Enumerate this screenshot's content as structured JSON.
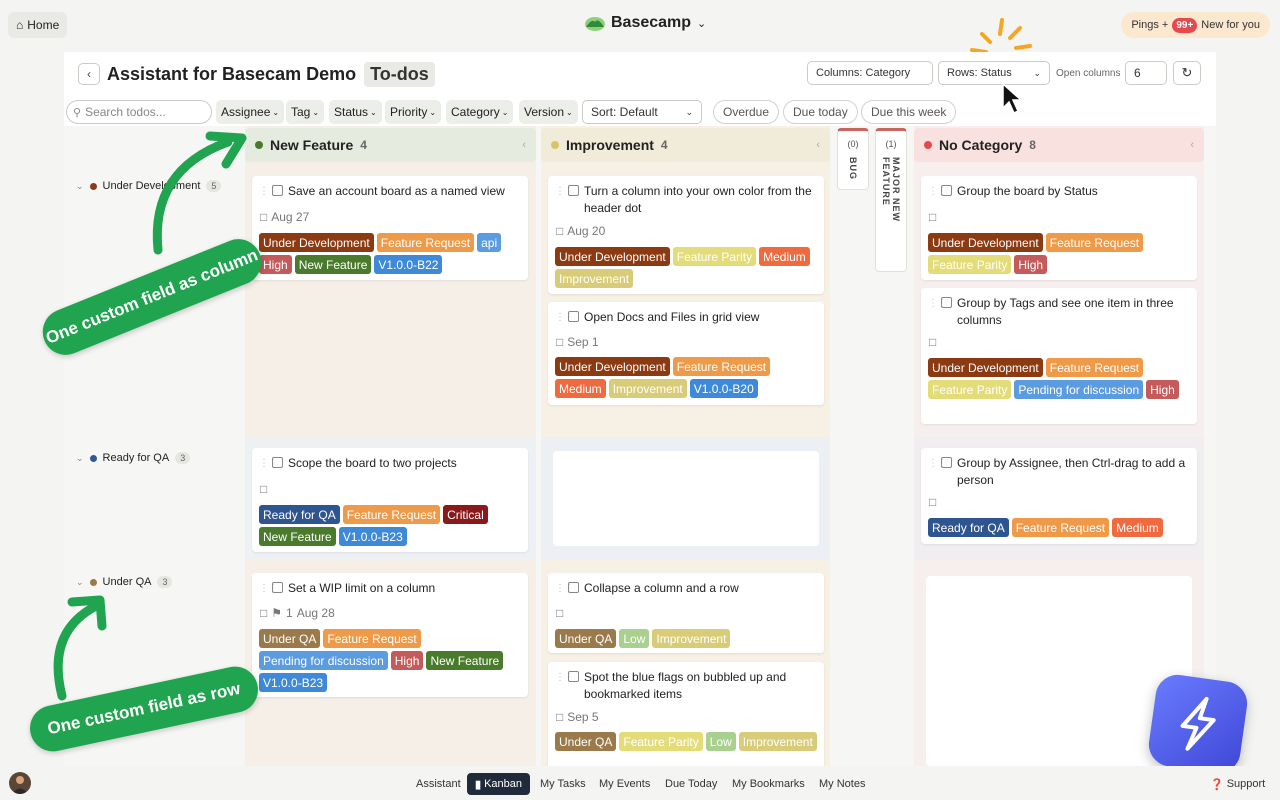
{
  "topbar": {
    "home_label": "Home",
    "brand": "Basecamp",
    "pings_label": "Pings +",
    "pings_count": "99+",
    "new_for_you": "New for you"
  },
  "header": {
    "title": "Assistant for Basecam Demo",
    "section": "To-dos",
    "columns_select": "Columns: Category",
    "rows_select": "Rows: Status",
    "open_columns_label": "Open columns",
    "open_columns_value": "6"
  },
  "filters": {
    "search_placeholder": "Search todos...",
    "chips": [
      "Assignee",
      "Tag",
      "Status",
      "Priority",
      "Category",
      "Version"
    ],
    "sort": "Sort: Default",
    "pills": [
      "Overdue",
      "Due today",
      "Due this week"
    ]
  },
  "columns": [
    {
      "name": "New Feature",
      "count": "4",
      "color": "#4a7a2c"
    },
    {
      "name": "Improvement",
      "count": "4",
      "color": "#d6c46a"
    },
    {
      "name": "No Category",
      "count": "8",
      "color": "#e5484d"
    }
  ],
  "collapsed_columns": [
    {
      "count": "(0)",
      "name": "BUG"
    },
    {
      "count": "(1)",
      "name": "MAJOR NEW FEATURE"
    }
  ],
  "rows": [
    {
      "name": "Under Development",
      "count": "5",
      "color": "#8b3a1a"
    },
    {
      "name": "Ready for QA",
      "count": "3",
      "color": "#2e5a9a"
    },
    {
      "name": "Under QA",
      "count": "3",
      "color": "#9a7a4a"
    }
  ],
  "cards": {
    "c1": {
      "title": "Save an account board as a named view",
      "date": "Aug 27",
      "tags": [
        "Under Development",
        "Feature Request",
        "api",
        "High",
        "New Feature",
        "V1.0.0-B22"
      ]
    },
    "c2": {
      "title": "Turn a column into your own color from the header dot",
      "date": "Aug 20",
      "tags": [
        "Under Development",
        "Feature Parity",
        "Medium",
        "Improvement"
      ]
    },
    "c3": {
      "title": "Open Docs and Files in grid view",
      "date": "Sep 1",
      "tags": [
        "Under Development",
        "Feature Request",
        "Medium",
        "Improvement",
        "V1.0.0-B20"
      ]
    },
    "c4": {
      "title": "Group the board by Status",
      "tags": [
        "Under Development",
        "Feature Request",
        "Feature Parity",
        "High"
      ]
    },
    "c5": {
      "title": "Group by Tags and see one item in three columns",
      "tags": [
        "Under Development",
        "Feature Request",
        "Feature Parity",
        "Pending for discussion",
        "High"
      ]
    },
    "c6": {
      "title": "Scope the board to two projects",
      "tags": [
        "Ready for QA",
        "Feature Request",
        "Critical",
        "New Feature",
        "V1.0.0-B23"
      ]
    },
    "c7": {
      "title": "Group by Assignee, then Ctrl-drag to add a person",
      "tags": [
        "Ready for QA",
        "Feature Request",
        "Medium"
      ]
    },
    "c8": {
      "title": "Set a WIP limit on a column",
      "comments": "1",
      "date": "Aug 28",
      "tags": [
        "Under QA",
        "Feature Request",
        "Pending for discussion",
        "High",
        "New Feature",
        "V1.0.0-B23"
      ]
    },
    "c9": {
      "title": "Collapse a column and a row",
      "tags": [
        "Under QA",
        "Low",
        "Improvement"
      ]
    },
    "c10": {
      "title": "Spot the blue flags on bubbled up and bookmarked items",
      "date": "Sep 5",
      "tags": [
        "Under QA",
        "Feature Parity",
        "Low",
        "Improvement"
      ]
    }
  },
  "tag_colors": {
    "Under Development": "#8b3a12",
    "Feature Request": "#ef9a48",
    "api": "#5b9be0",
    "High": "#c45a5a",
    "New Feature": "#4a7a2c",
    "V1.0.0-B22": "#3f8ad8",
    "V1.0.0-B20": "#3f8ad8",
    "V1.0.0-B23": "#3f8ad8",
    "Feature Parity": "#e3dc78",
    "Medium": "#ef6a3e",
    "Improvement": "#d8cc78",
    "Pending for discussion": "#5b9be0",
    "Ready for QA": "#2f5590",
    "Critical": "#8a1a1a",
    "Under QA": "#9a7a4a",
    "Low": "#a9d08e"
  },
  "callouts": {
    "column": "One custom field as column",
    "row": "One custom field as row"
  },
  "bottombar": {
    "items": [
      "Assistant",
      "Kanban",
      "My Tasks",
      "My Events",
      "Due Today",
      "My Bookmarks",
      "My Notes"
    ],
    "active": "Kanban",
    "support": "Support"
  }
}
